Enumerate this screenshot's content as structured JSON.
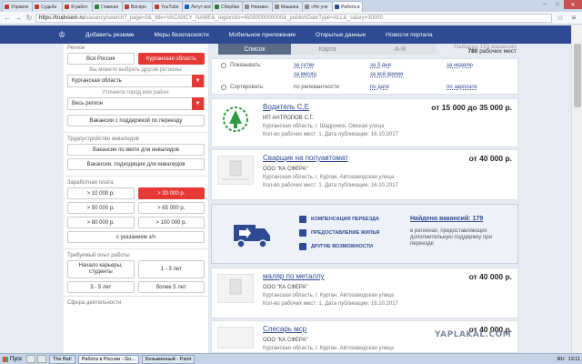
{
  "browser": {
    "tabs": [
      {
        "label": "Управле",
        "color": "#c0392b"
      },
      {
        "label": "Судьба",
        "color": "#c0392b"
      },
      {
        "label": "Я работ",
        "color": "#c0392b"
      },
      {
        "label": "Главная",
        "color": "#2e7d32"
      },
      {
        "label": "Воспро",
        "color": "#c0392b"
      },
      {
        "label": "YouTube",
        "color": "#c0392b"
      },
      {
        "label": "Летут вос",
        "color": "#1565c0"
      },
      {
        "label": "Сбербан",
        "color": "#2e7d32"
      },
      {
        "label": "Неизвес",
        "color": "#888888"
      },
      {
        "label": "Машина",
        "color": "#888888"
      },
      {
        "label": "«Не уче",
        "color": "#888888"
      },
      {
        "label": "Работа в",
        "color": "#2e4a93",
        "active": true
      }
    ],
    "url_host": "https://trudvsem.ru",
    "url_path": "/vacancy/search?_page=0&_title=VACANCY_NAME&_regionIds=4500000000000&_publishDateType=ALL&_salary=30000"
  },
  "site_nav": {
    "items": [
      "Добавить резюме",
      "Меры безопасности",
      "Мобильное приложение",
      "Открытые данные",
      "Новости портала"
    ]
  },
  "left": {
    "region_title": "Регион",
    "region_all": "Вся Россия",
    "region_selected": "Курганская область",
    "other_regions_label": "Вы можете выбрать другие регионы:",
    "region_select": "Курганская область",
    "city_label": "Уточните город или район:",
    "city_select": "Весь регион",
    "relocation_btn": "Вакансии с поддержкой по переезду",
    "disabled_title": "Трудоустройство инвалидов",
    "disabled_quota": "Вакансии по квоте для инвалидов",
    "disabled_suitable": "Вакансии, подходящие для инвалидов",
    "salary_title": "Заработная плата",
    "salary_opts": [
      "> 10 000 р.",
      "> 30 000 р.",
      "> 50 000 р.",
      "> 65 000 р.",
      "> 80 000 р.",
      "> 100 000 р."
    ],
    "salary_with": "с указанием з/п",
    "exp_title": "Требуемый опыт работы",
    "exp_opts": [
      "Начало карьеры, студенты",
      "1 - 3 лет",
      "3 - 5 лет",
      "более 5 лет"
    ],
    "sphere_title": "Сфера деятельности"
  },
  "main": {
    "view_tabs": [
      "Список",
      "Карта",
      "А-Я"
    ],
    "stats_top": "Найдено 163 вакансии",
    "stats_count": "780",
    "stats_suffix": "рабочих мест",
    "show_label": "Показывать:",
    "show_opts": [
      "за сутки",
      "за 3 дня",
      "за неделю",
      "за месяц",
      "за всё время"
    ],
    "sort_label": "Сортировать:",
    "sort_opts": [
      "по релевантности",
      "по дате",
      "по зарплате"
    ],
    "jobs": [
      {
        "title": "Водитель С,Е",
        "salary": "от 15 000 до 35 000 р.",
        "company": "ИП АНТРОПОВ С.Г.",
        "address": "Курганская область, г. Шадринск, Омская улица",
        "meta": "Кол-во рабочих мест: 1. Дата публикации: 16.10.2017"
      },
      {
        "title": "Сварщик на полуавтомат",
        "salary": "от 40 000 р.",
        "company": "ООО \"КА СФЕРА\"",
        "address": "Курганская область, г. Курган, Автозаводская улица",
        "meta": "Кол-во рабочих мест: 1. Дата публикации: 16.10.2017"
      },
      {
        "title": "маляр по металлу",
        "salary": "от 40 000 р.",
        "company": "ООО \"КА СФЕРА\"",
        "address": "Курганская область, г. Курган, Автозаводская улица",
        "meta": "Кол-во рабочих мест: 1. Дата публикации: 16.10.2017"
      },
      {
        "title": "Слесарь мср",
        "salary": "от 40 000 р.",
        "company": "ООО \"КА СФЕРА\"",
        "address": "Курганская область, г. Курган, Автозаводская улица",
        "meta": ""
      }
    ],
    "logo_placeholder": "РАБОТА В РОССИИ",
    "banner": {
      "features": [
        "КОМПЕНСАЦИЯ ПЕРЕЕЗДА",
        "ПРЕДОСТАВЛЕНИЕ ЖИЛЬЯ",
        "ДРУГИЕ ВОЗМОЖНОСТИ"
      ],
      "found": "Найдено вакансий: 179",
      "desc": "в регионах, предоставляющих дополнительную поддержку при переезде"
    }
  },
  "watermark": "YAPLAKAL.COM",
  "taskbar": {
    "start": "Пуск",
    "tasks": [
      "The Bat!",
      "Работа в России - Go...",
      "Безымянный - Paint"
    ],
    "lang": "RU",
    "time": "13:11"
  }
}
